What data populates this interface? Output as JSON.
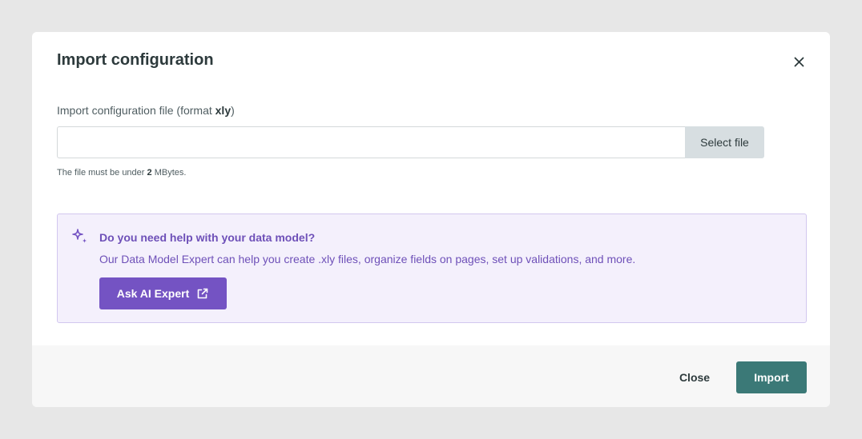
{
  "dialog": {
    "title": "Import configuration",
    "close_icon": "close-icon"
  },
  "file_field": {
    "label_prefix": "Import configuration file (format ",
    "label_format": "xly",
    "label_suffix": ")",
    "value": "",
    "placeholder": "",
    "select_button_label": "Select file",
    "hint_prefix": "The file must be under ",
    "hint_size": "2",
    "hint_suffix": " MBytes."
  },
  "ai_help": {
    "icon": "sparkle-icon",
    "title": "Do you need help with your data model?",
    "description": "Our Data Model Expert can help you create .xly files, organize fields on pages, set up validations, and more.",
    "button_label": "Ask AI Expert",
    "button_icon": "external-link-icon"
  },
  "footer": {
    "close_label": "Close",
    "import_label": "Import"
  },
  "colors": {
    "overlay": "#e7e7e7",
    "primary": "#3b7977",
    "ai_accent": "#7453c3",
    "ai_text": "#6e50b8",
    "ai_background": "#f4f0fc"
  }
}
